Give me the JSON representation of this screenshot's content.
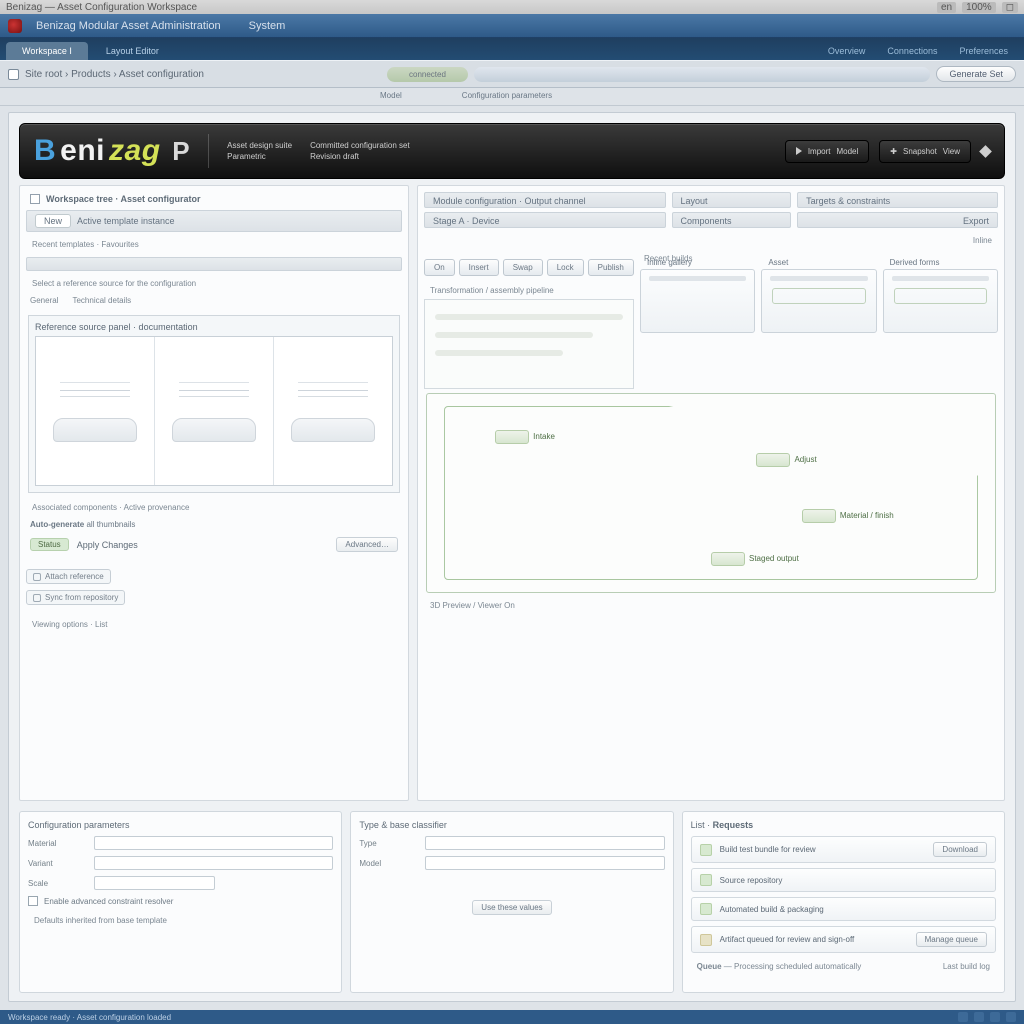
{
  "os": {
    "title": "Benizag — Asset Configuration Workspace",
    "ctl1": "en",
    "ctl2": "100%",
    "ctl3": "◻"
  },
  "appmenu": {
    "title": "Benizag Modular Asset Administration",
    "extra": "System"
  },
  "tabs": {
    "t1": "Workspace I",
    "t2": "Layout Editor",
    "l1": "Overview",
    "l2": "Connections",
    "l3": "Preferences"
  },
  "toolbar": {
    "address": "Site root › Products › Asset configuration",
    "pill1": "connected",
    "pill2": "",
    "action": "Generate Set"
  },
  "subtabs": {
    "s1": "Model",
    "s2": "Configuration parameters"
  },
  "hero": {
    "sub1a": "Asset design suite",
    "sub1b": "Parametric",
    "sub2a": "Committed configuration set",
    "sub2b": "Revision draft",
    "btn1a": "Import",
    "btn1b": "Model",
    "btn2a": "✚",
    "btn2b": "Snapshot",
    "btn2c": "View"
  },
  "left": {
    "header": "Workspace tree · Asset configurator",
    "band1_pill": "New",
    "band1_txt": "Active template instance",
    "note1": "Recent templates · Favourites",
    "frame_note": "Select a reference source for the configuration",
    "tabA": "General",
    "tabB": "Technical details",
    "frame_title": "Reference source panel · documentation",
    "note2": "Associated components · Active provenance",
    "opt_label": "Auto-generate",
    "opt_val": "all thumbnails",
    "tag": "Status",
    "chg": "Apply Changes",
    "ghost": "Advanced…",
    "mb1": "Attach reference",
    "mb2": "Sync from repository",
    "foot": "Viewing options · List"
  },
  "right": {
    "hdrL": "Module configuration · Output channel",
    "hdrR_a": "Layout",
    "hdrR_b": "Targets & constraints",
    "row2a": "Stage A · Device",
    "row2b": "Components",
    "row2c": "Export",
    "note": "Inline",
    "g_title": "Inline gallery",
    "g0": "Recent builds",
    "g1": "Asset",
    "g2": "Derived forms",
    "bb1": "On",
    "bb2": "Insert",
    "bb3": "Swap",
    "bb4": "Lock",
    "bb5": "Publish",
    "sec": "Transformation / assembly pipeline",
    "d1": "Intake",
    "d2": "Adjust",
    "d3": "Material / finish",
    "d4": "Staged output",
    "viewer": "3D Preview / Viewer On"
  },
  "low": {
    "c1": "Configuration parameters",
    "f1": "Material",
    "f2": "Variant",
    "f3": "Scale",
    "chk": "Enable advanced constraint resolver",
    "c1_note": "Defaults inherited from base template",
    "c2": "Type & base classifier",
    "c2_f1": "Type",
    "c2_f2": "Model",
    "c2_btn": "Use these values",
    "c3": "List",
    "c3_h": "Requests",
    "li1": "Build test bundle for review",
    "li1b": "Download",
    "li2": "Source repository",
    "li3": "Automated build & packaging",
    "li4": "Artifact queued for review and sign-off",
    "li4b": "Manage queue",
    "c3_foot1": "Queue",
    "c3_foot2": "Processing scheduled automatically",
    "li5b": "Last build log"
  },
  "status": {
    "text": "Workspace ready · Asset configuration loaded"
  }
}
